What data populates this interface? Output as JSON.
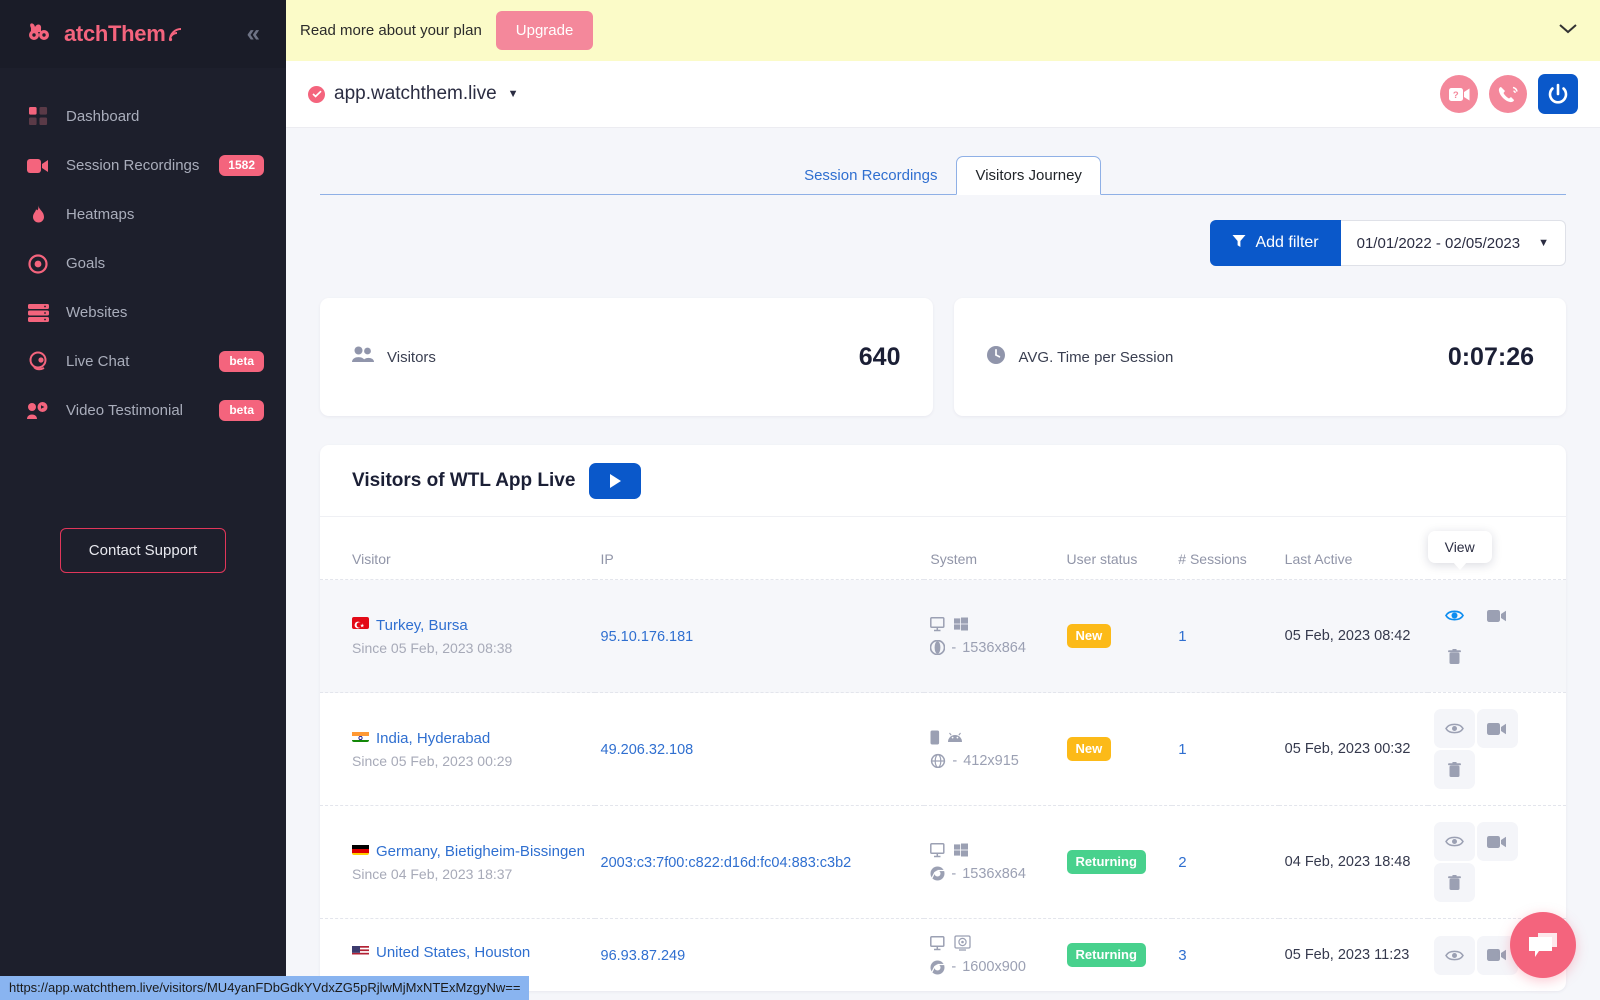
{
  "sidebar": {
    "logo_text": "atchThem",
    "collapse_icon": "chevron-double-left-icon",
    "items": [
      {
        "label": "Dashboard",
        "icon": "grid-icon",
        "badge": "",
        "badge_type": "none"
      },
      {
        "label": "Session Recordings",
        "icon": "video-icon",
        "badge": "1582",
        "badge_type": "count"
      },
      {
        "label": "Heatmaps",
        "icon": "flame-icon",
        "badge": "",
        "badge_type": "none"
      },
      {
        "label": "Goals",
        "icon": "target-icon",
        "badge": "",
        "badge_type": "none"
      },
      {
        "label": "Websites",
        "icon": "server-icon",
        "badge": "",
        "badge_type": "none"
      },
      {
        "label": "Live Chat",
        "icon": "headset-icon",
        "badge": "beta",
        "badge_type": "beta"
      },
      {
        "label": "Video Testimonial",
        "icon": "user-video-icon",
        "badge": "beta",
        "badge_type": "beta"
      }
    ],
    "contact_support_label": "Contact Support"
  },
  "banner": {
    "text": "Read more about your plan",
    "upgrade_label": "Upgrade",
    "collapse_icon": "chevron-down-icon",
    "bg_color": "#fbfbc8"
  },
  "sitebar": {
    "site_name": "app.watchthem.live",
    "verified_icon": "check-circle-icon",
    "dropdown_icon": "caret-down-icon",
    "actions": [
      {
        "icon": "help-video-icon",
        "color": "#f4889b"
      },
      {
        "icon": "phone-call-icon",
        "color": "#f4889b"
      },
      {
        "icon": "power-icon",
        "color": "#0a58ca"
      }
    ]
  },
  "tabs": [
    {
      "label": "Session Recordings",
      "active": false
    },
    {
      "label": "Visitors Journey",
      "active": true
    }
  ],
  "filters": {
    "add_filter_label": "Add filter",
    "filter_icon": "funnel-icon",
    "date_range": "01/01/2022 - 02/05/2023",
    "date_caret_icon": "caret-down-icon"
  },
  "stats": [
    {
      "label": "Visitors",
      "value": "640",
      "icon": "people-icon"
    },
    {
      "label": "AVG. Time per Session",
      "value": "0:07:26",
      "icon": "clock-icon"
    }
  ],
  "table_panel": {
    "title": "Visitors of WTL App Live",
    "play_icon": "play-icon",
    "columns": [
      "Visitor",
      "IP",
      "System",
      "User status",
      "# Sessions",
      "Last Active",
      ""
    ],
    "tooltip": "View",
    "action_icons": [
      "eye-icon",
      "video-camera-icon",
      "trash-icon"
    ],
    "rows": [
      {
        "country": "Turkey, Bursa",
        "flag": "tr",
        "since": "Since 05 Feb, 2023 08:38",
        "ip": "95.10.176.181",
        "device_icon": "desktop-icon",
        "os_icon": "windows-icon",
        "browser_icon": "opera-icon",
        "resolution": "1536x864",
        "status": "New",
        "status_type": "new",
        "sessions": "1",
        "last_active": "05 Feb, 2023 08:42",
        "highlighted": true,
        "show_tooltip": true
      },
      {
        "country": "India, Hyderabad",
        "flag": "in",
        "since": "Since 05 Feb, 2023 00:29",
        "ip": "49.206.32.108",
        "device_icon": "mobile-icon",
        "os_icon": "android-icon",
        "browser_icon": "browser-icon",
        "resolution": "412x915",
        "status": "New",
        "status_type": "new",
        "sessions": "1",
        "last_active": "05 Feb, 2023 00:32",
        "highlighted": false,
        "show_tooltip": false
      },
      {
        "country": "Germany, Bietigheim-Bissingen",
        "flag": "de",
        "since": "Since 04 Feb, 2023 18:37",
        "ip": "2003:c3:7f00:c822:d16d:fc04:883:c3b2",
        "device_icon": "desktop-icon",
        "os_icon": "windows-icon",
        "browser_icon": "chrome-icon",
        "resolution": "1536x864",
        "status": "Returning",
        "status_type": "returning",
        "sessions": "2",
        "last_active": "04 Feb, 2023 18:48",
        "highlighted": false,
        "show_tooltip": false
      },
      {
        "country": "United States, Houston",
        "flag": "us",
        "since": "",
        "ip": "96.93.87.249",
        "device_icon": "desktop-icon",
        "os_icon": "linux-icon",
        "browser_icon": "chrome-icon",
        "resolution": "1600x900",
        "status": "Returning",
        "status_type": "returning",
        "sessions": "3",
        "last_active": "05 Feb, 2023 11:23",
        "highlighted": false,
        "show_tooltip": false
      }
    ]
  },
  "chat_widget": {
    "icon": "chat-bubbles-icon",
    "color": "#f4647d"
  },
  "status_bar": {
    "url": "https://app.watchthem.live/visitors/MU4yanFDbGdkYVdxZG5pRjlwMjMxNTExMzgyNw=="
  }
}
